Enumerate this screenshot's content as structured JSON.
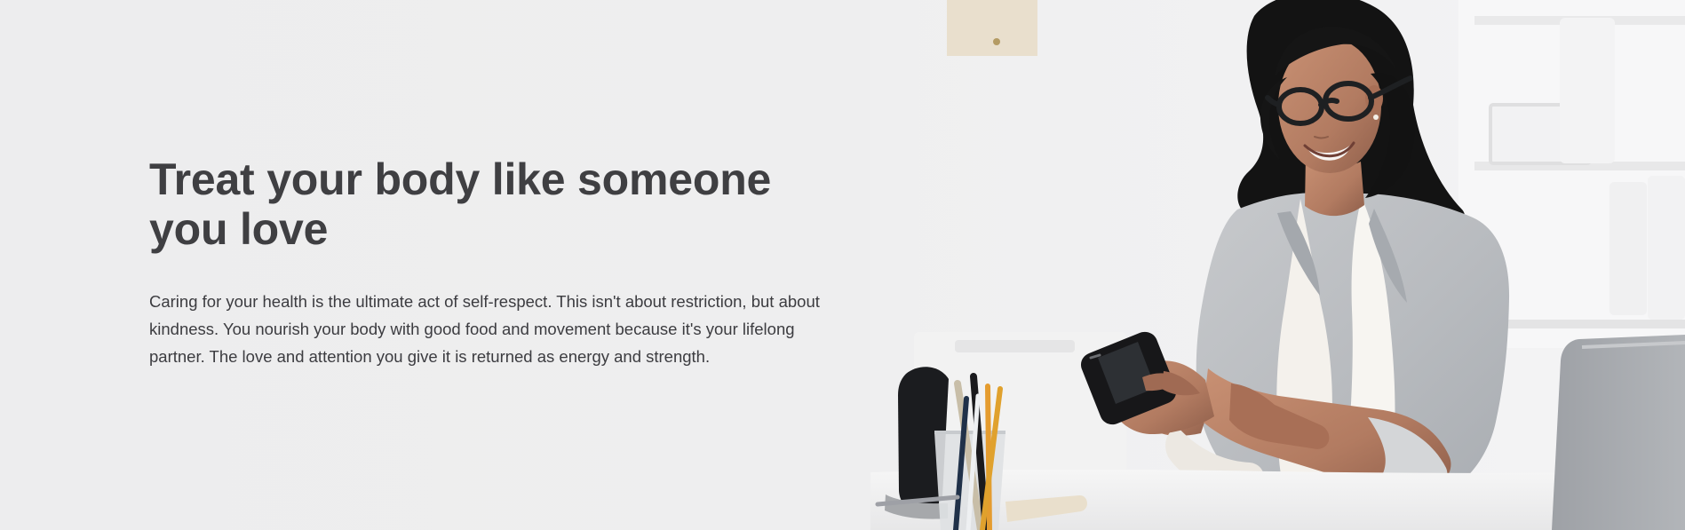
{
  "hero": {
    "title": "Treat your body like someone you love",
    "body": "Caring for your health is the ultimate act of self-respect. This isn't about restriction, but about kindness. You nourish your body with good food and movement because it's your lifelong partner. The love and attention you give it is returned as energy and strength."
  },
  "image": {
    "subject": "woman-smiling-at-phone",
    "colors": {
      "background": "#eeeeef",
      "title": "#3f3f42",
      "body": "#3c3c40",
      "jacket": "#b9bcc0",
      "blouse": "#f4f1ec",
      "hair": "#121212",
      "skin": "#b27b61",
      "desk": "#f3f3f3"
    }
  }
}
